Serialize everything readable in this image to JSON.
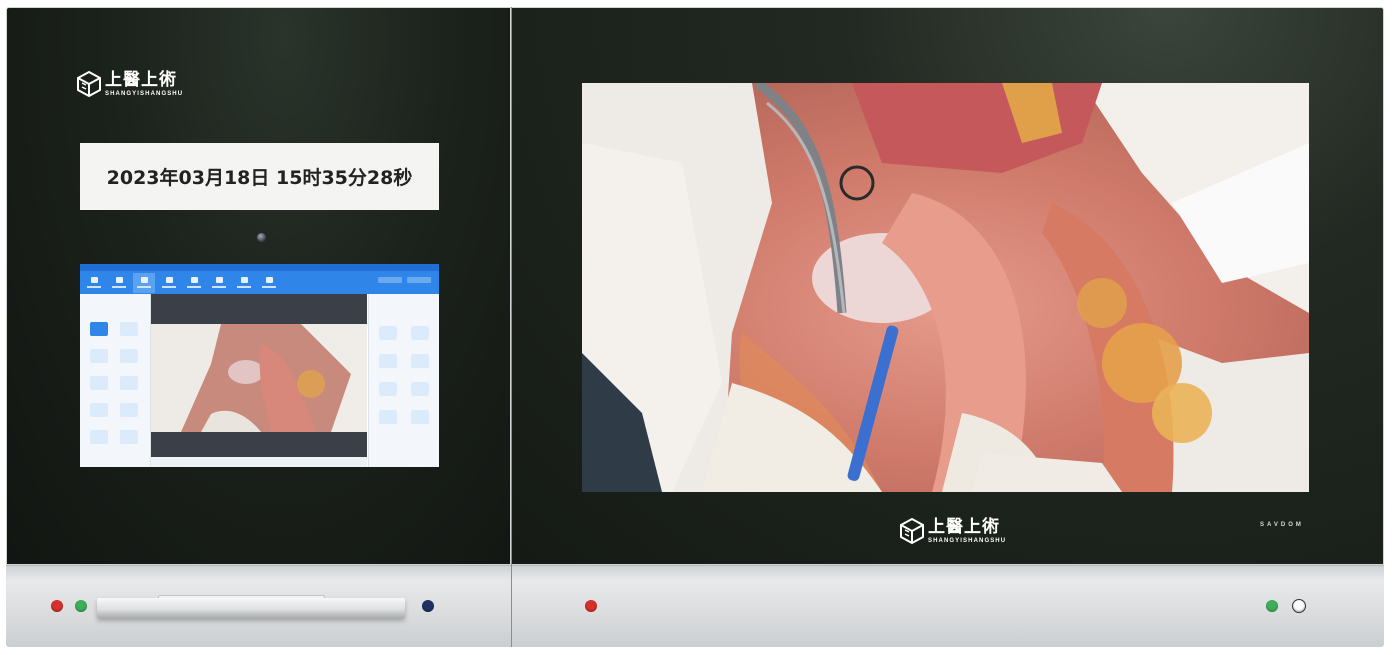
{
  "left_panel": {
    "logo": {
      "cn": "上醫上術",
      "en": "SHANGYISHANGSHU",
      "icon": "cube-logo-icon"
    },
    "datetime": "2023年03月18日  15时35分28秒"
  },
  "right_panel": {
    "logo": {
      "cn": "上醫上術",
      "en": "SHANGYISHANGSHU",
      "icon": "cube-logo-icon"
    },
    "brand": "SAVDOM"
  },
  "colors": {
    "panel_bg": "#1b211b",
    "app_toolbar": "#2f86e8",
    "indicator_red": "#d8312b",
    "indicator_green": "#3fae5a",
    "indicator_navy": "#1f3263",
    "indicator_white": "#ffffff"
  },
  "indicators": {
    "left_base": [
      "red",
      "green",
      "navy"
    ],
    "right_base": [
      "red",
      "green",
      "white"
    ]
  }
}
